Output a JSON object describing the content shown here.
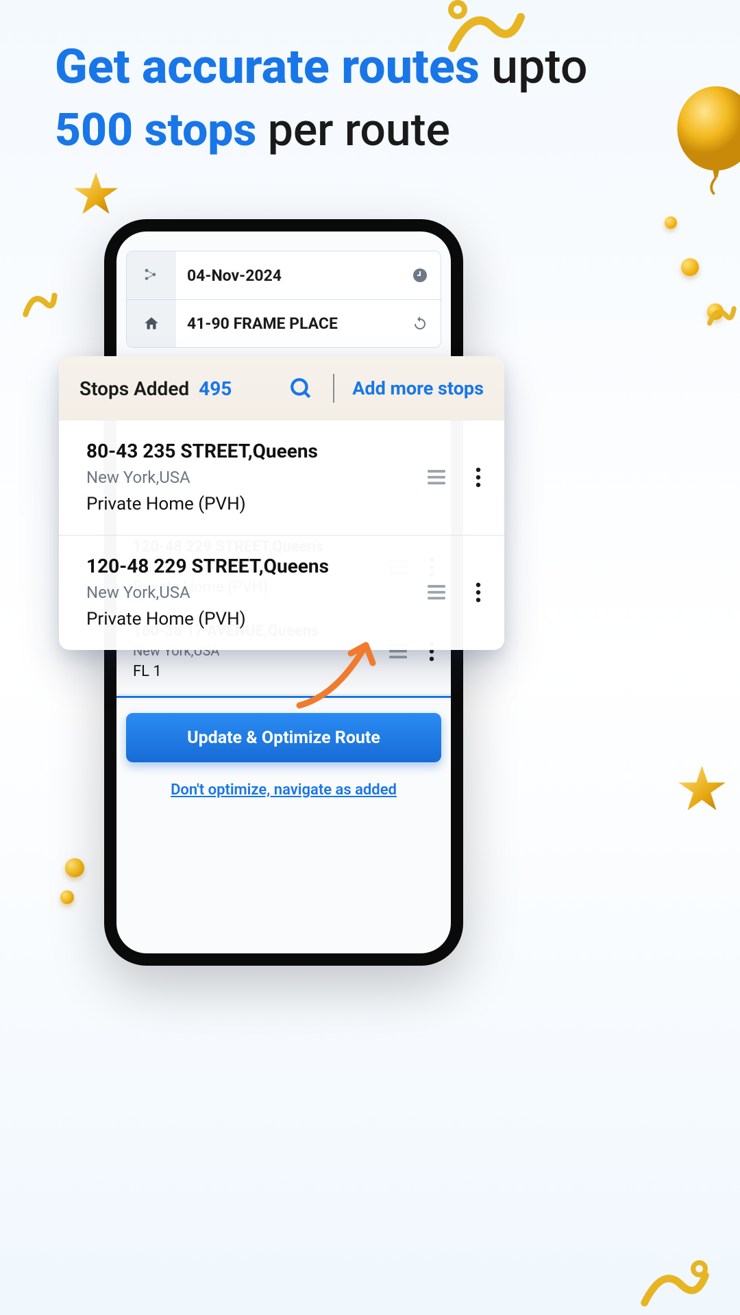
{
  "headline": {
    "l1_bold": "Get accurate routes",
    "l1_rest": " upto",
    "l2_bold": "500 stops",
    "l2_rest": " per route"
  },
  "top_card": {
    "date": "04-Nov-2024",
    "place": "41-90 FRAME PLACE"
  },
  "float": {
    "label": "Stops Added",
    "count": "495",
    "add_label": "Add more stops",
    "items": [
      {
        "title": "80-43 235 STREET,Queens",
        "sub": "New York,USA",
        "cat": "Private Home (PVH)"
      },
      {
        "title": "120-48 229 STREET,Queens",
        "sub": "New York,USA",
        "cat": "Private Home (PVH)"
      }
    ]
  },
  "phone_list": [
    {
      "title": "120-48 229 STREET,Queens",
      "sub": "New York,USA",
      "cat": "Private Home (PVH)"
    },
    {
      "title": "160-38 17 AVENUE,Queens",
      "sub": "New York,USA",
      "cat": "FL 1"
    }
  ],
  "buttons": {
    "primary": "Update & Optimize Route",
    "secondary": "Don't optimize, navigate as added"
  },
  "colors": {
    "accent": "#1876e8",
    "gold": "#f2b516"
  }
}
